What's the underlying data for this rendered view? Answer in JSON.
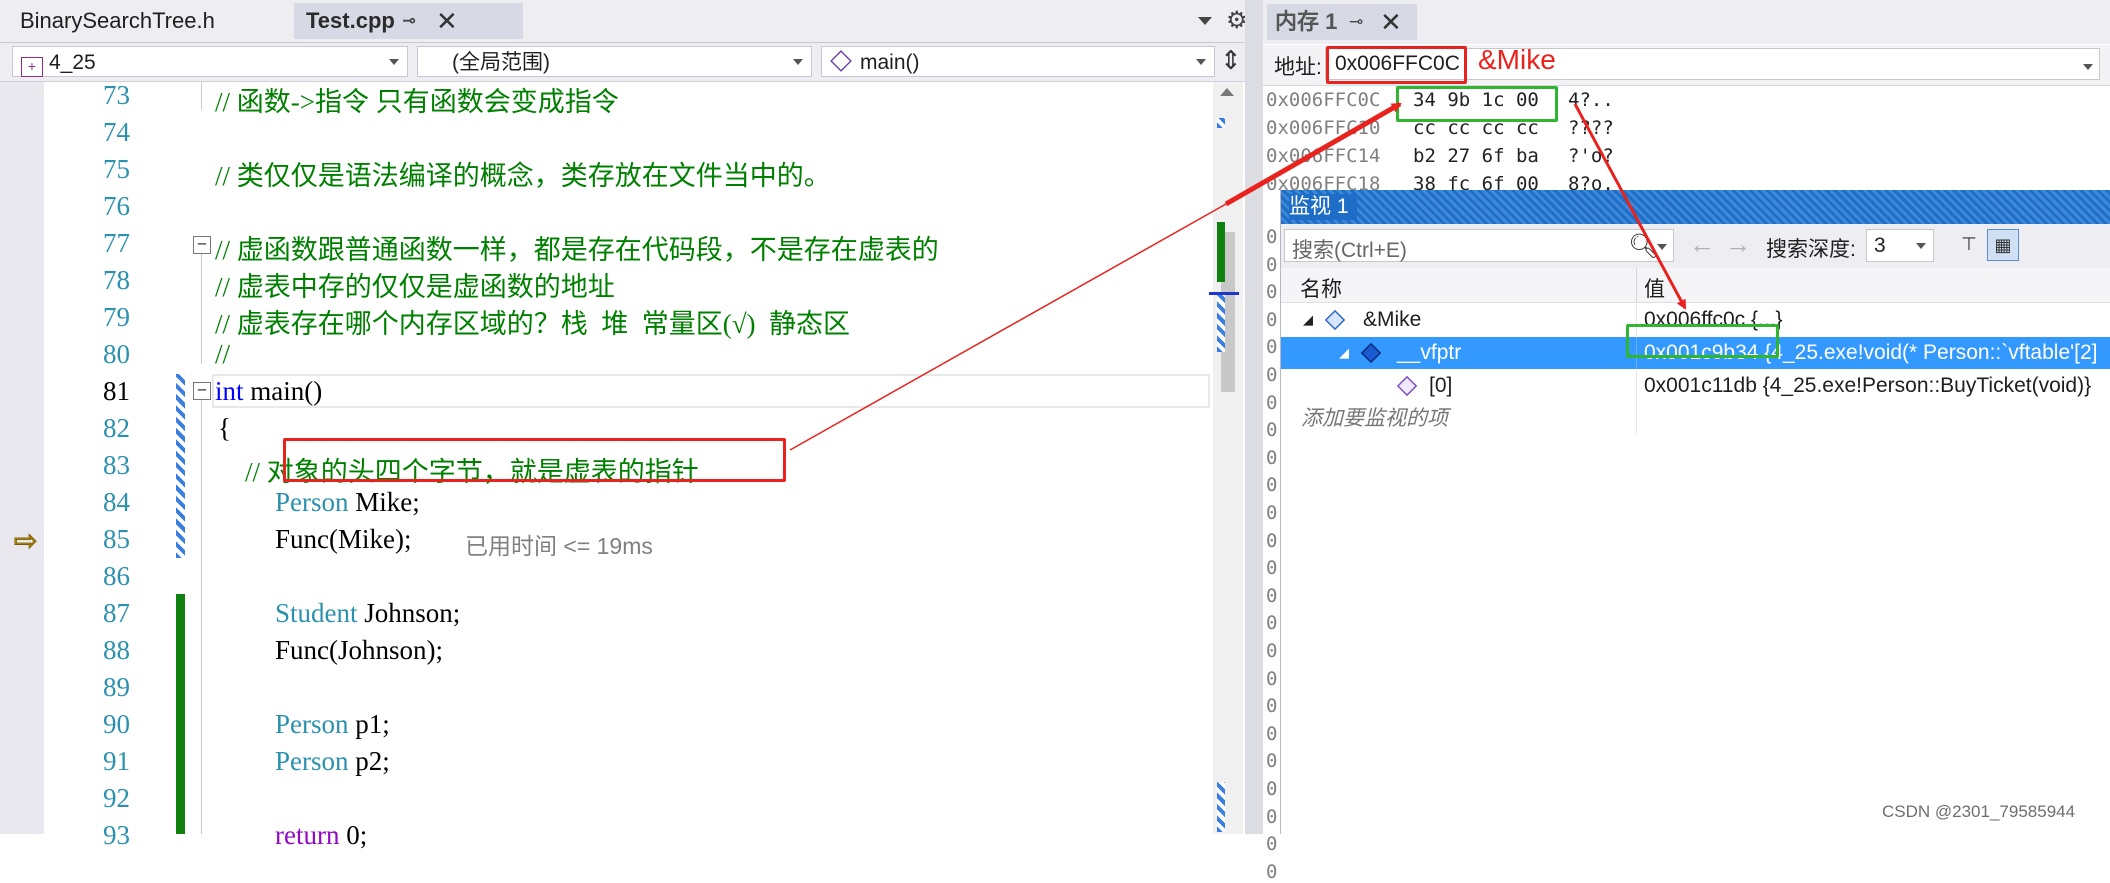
{
  "tabs": {
    "bst": "BinarySearchTree.h",
    "test": "Test.cpp",
    "pin": "⊸",
    "close": "✕"
  },
  "nav": {
    "project": "4_25",
    "scope": "(全局范围)",
    "function": "main()"
  },
  "editor": {
    "lines": [
      {
        "n": "73",
        "text": "// 函数->指令 只有函数会变成指令"
      },
      {
        "n": "74",
        "text": ""
      },
      {
        "n": "75",
        "text": "// 类仅仅是语法编译的概念，类存放在文件当中的。"
      },
      {
        "n": "76",
        "text": ""
      },
      {
        "n": "77",
        "text": "// 虚函数跟普通函数一样，都是存在代码段，不是存在虚表的"
      },
      {
        "n": "78",
        "text": "// 虚表中存的仅仅是虚函数的地址"
      },
      {
        "n": "79",
        "text": "// 虚表存在哪个内存区域的？栈  堆  常量区(√)  静态区"
      },
      {
        "n": "80",
        "text": "//"
      },
      {
        "n": "81",
        "kw": "int",
        "text": " main()"
      },
      {
        "n": "82",
        "text": "{"
      },
      {
        "n": "83",
        "text": "// 对象的头四个字节，就是虚表的指针"
      },
      {
        "n": "84",
        "ty": "Person",
        "text": " Mike;"
      },
      {
        "n": "85",
        "text": "Func(Mike);"
      },
      {
        "n": "86",
        "text": ""
      },
      {
        "n": "87",
        "ty": "Student",
        "text": " Johnson;"
      },
      {
        "n": "88",
        "text": "Func(Johnson);"
      },
      {
        "n": "89",
        "text": ""
      },
      {
        "n": "90",
        "ty": "Person",
        "text": " p1;"
      },
      {
        "n": "91",
        "ty": "Person",
        "text": " p2;"
      },
      {
        "n": "92",
        "text": ""
      },
      {
        "n": "93",
        "kw": "return",
        "text": " 0;"
      }
    ],
    "perf_hint": "已用时间 <= 19ms"
  },
  "memory": {
    "title": "内存 1",
    "address_label": "地址:",
    "address_value": "0x006FFC0C",
    "annotation": "&Mike",
    "rows": [
      {
        "addr": "0x006FFC0C",
        "bytes": "34 9b 1c 00",
        "chars": "4?.."
      },
      {
        "addr": "0x006FFC10",
        "bytes": "cc cc cc cc",
        "chars": "????"
      },
      {
        "addr": "0x006FFC14",
        "bytes": "b2 27 6f ba",
        "chars": "?'o?"
      },
      {
        "addr": "0x006FFC18",
        "bytes": "38 fc 6f 00",
        "chars": "8?o."
      }
    ],
    "truncated_addr": "0"
  },
  "watch": {
    "title": "监视 1",
    "search_placeholder": "搜索(Ctrl+E)",
    "depth_label": "搜索深度:",
    "depth_value": "3",
    "col_name": "名称",
    "col_value": "值",
    "rows": [
      {
        "name": "&Mike",
        "value": "0x006ffc0c {...}"
      },
      {
        "name": "__vfptr",
        "value": "0x001c9b34 {4_25.exe!void(* Person::`vftable'[2]"
      },
      {
        "name": "[0]",
        "value": "0x001c11db {4_25.exe!Person::BuyTicket(void)}"
      }
    ],
    "add_item": "添加要监视的项"
  },
  "watermark": "CSDN @2301_79585944",
  "colors": {
    "annotation_red": "#e8231e",
    "annotation_green": "#2fb52f",
    "selection_blue": "#3399ff",
    "comment_green": "#008000"
  }
}
